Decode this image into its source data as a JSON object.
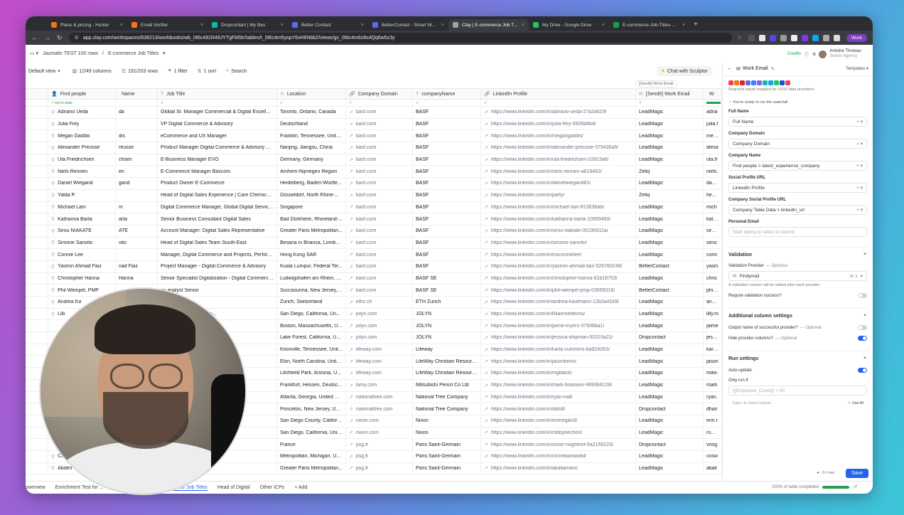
{
  "browser": {
    "tabs": [
      {
        "label": "Plans & pricing - Hunter",
        "color": "#f97316"
      },
      {
        "label": "Email Verifier",
        "color": "#f97316"
      },
      {
        "label": "Dropcontact | My files",
        "color": "#14b8a6"
      },
      {
        "label": "Better Contact",
        "color": "#6366f1"
      },
      {
        "label": "BetterContact - Smart Waterf",
        "color": "#6366f1"
      },
      {
        "label": "Clay | E-commerce Job Titles",
        "color": "#9ca3af",
        "active": true
      },
      {
        "label": "My Drive - Google Drive",
        "color": "#22c55e"
      },
      {
        "label": "E-commerce-Job-Titles-Defa",
        "color": "#16a34a"
      }
    ],
    "new_tab": "+",
    "url": "app.clay.com/workspaces/638213/workbooks/wb_0t6c481R49JYTgFM5tr/tables/t_0t6c4m5yspY6xH6Nbb2/views/gv_0t6c4m6z8s4Qq6w5z3y",
    "profile_label": "Work"
  },
  "app": {
    "breadcrumbs": [
      "Jaumatic TEST 100 rows",
      "/",
      "E-commerce Job Titles"
    ],
    "credits": "Credits",
    "user_name": "Antoine Thoreau",
    "user_org": "Sendo Agency"
  },
  "toolbar": {
    "view": "Default view",
    "columns": "12/49 columns",
    "rows": "191/203 rows",
    "filter": "1 filter",
    "sort": "1 sort",
    "search": "Search",
    "chat": "Chat with Sculptor",
    "formula_hint": "[Sendō] Work Email"
  },
  "grid": {
    "headers": [
      "Find people",
      "Name",
      "Job Title",
      "Location",
      "Company Domain",
      "companyName",
      "LinkedIn Profile",
      "[Sendō] Work Email",
      "W"
    ],
    "status_label": "Up to date",
    "rows": [
      {
        "p": "Adriano Ueda",
        "n": "da",
        "j": "Global Sr. Manager Commercial & Digital Excellenc...",
        "l": "Toronto, Ontario, Canada",
        "d": "basf.com",
        "c": "BASF",
        "li": "https://www.linkedin.com/in/adriano-ueda-27a2a619/",
        "w": "LeadMagic",
        "x": "adria"
      },
      {
        "p": "Julia Frey",
        "n": "",
        "j": "VP Digital Commerce & Advisory",
        "l": "Deutschland",
        "d": "basf.com",
        "c": "BASF",
        "li": "https://www.linkedin.com/in/julia-frey-0506b8b4/",
        "w": "LeadMagic",
        "x": "julia.f"
      },
      {
        "p": "Megan Gaddis",
        "n": "dis",
        "j": "eCommerce and UX Manager",
        "l": "Franklin, Tennessee, Unite...",
        "d": "basf.com",
        "c": "BASF",
        "li": "https://www.linkedin.com/in/megangaddis/",
        "w": "LeadMagic",
        "x": "mega"
      },
      {
        "p": "Alexander Preusse",
        "n": "reusse",
        "j": "Product Manager Digital Commerce & Advisory Chi...",
        "l": "Nanjing, Jiangsu, China",
        "d": "basf.com",
        "c": "BASF",
        "li": "https://www.linkedin.com/in/alexander-preusse-375436a5/",
        "w": "LeadMagic",
        "x": "alexa"
      },
      {
        "p": "Uta Friedrichsen",
        "n": "chsen",
        "j": "E-Business Manager EVO",
        "l": "Germany, Germany",
        "d": "basf.com",
        "c": "BASF",
        "li": "https://www.linkedin.com/in/uta-friedrichsen-22813a6/",
        "w": "LeadMagic",
        "x": "uta.fr"
      },
      {
        "p": "Niels Rennen",
        "n": "en",
        "j": "E-Commerce Manager Bascom",
        "l": "Arnhem-Nijmegen Region",
        "d": "basf.com",
        "c": "BASF",
        "li": "https://www.linkedin.com/in/niels-rennen-a819492/",
        "w": "Zeliq",
        "x": "niels."
      },
      {
        "p": "Daniel Wiegand",
        "n": "gand",
        "j": "Product Owner E-Commerce",
        "l": "Heidelberg, Baden-Württe...",
        "d": "basf.com",
        "c": "BASF",
        "li": "https://www.linkedin.com/in/danielwiegand81/",
        "w": "LeadMagic",
        "x": "danie"
      },
      {
        "p": "Yalda P.",
        "n": "",
        "j": "Head of Digital Sales Experience | Care Chemicals ...",
        "l": "Düsseldorf, North Rhine-...",
        "d": "basf.com",
        "c": "BASF",
        "li": "https://www.linkedin.com/in/party/",
        "w": "Zeliq",
        "x": "heary"
      },
      {
        "p": "Michael Lam",
        "n": "m",
        "j": "Digital Commerce Manager, Global Digital Services",
        "l": "Singapore",
        "d": "basf.com",
        "c": "BASF",
        "li": "https://www.linkedin.com/in/michael-lam-813636ab/",
        "w": "LeadMagic",
        "x": "mich"
      },
      {
        "p": "Katharina Barta",
        "n": "arta",
        "j": "Senior Business Consultant Digital Sales",
        "l": "Bad Dürkheim, Rhineland-...",
        "d": "basf.com",
        "c": "BASF",
        "li": "https://www.linkedin.com/in/katharina-barta-10959450/",
        "w": "LeadMagic",
        "x": "katha"
      },
      {
        "p": "Sirou NIAKATE",
        "n": "ATE",
        "j": "Account Manager: Digital Sales Representative",
        "l": "Greater Paris Metropolitan...",
        "d": "basf.com",
        "c": "BASF",
        "li": "https://www.linkedin.com/in/sirou-niakate-00190311a/",
        "w": "LeadMagic",
        "x": "sirou."
      },
      {
        "p": "Simone Sanvito",
        "n": "vito",
        "j": "Head of Digital Sales Team South-East",
        "l": "Besana in Brianza, Lombardi...",
        "d": "basf.com",
        "c": "BASF",
        "li": "https://www.linkedin.com/in/simone-sanvito/",
        "w": "LeadMagic",
        "x": "simo"
      },
      {
        "p": "Connie Lee",
        "n": "",
        "j": "Manager, Digital Commerce and Projects, Perform...",
        "l": "Hong Kong SAR",
        "d": "basf.com",
        "c": "BASF",
        "li": "https://www.linkedin.com/in/msconnielee/",
        "w": "LeadMagic",
        "x": "conn"
      },
      {
        "p": "Yasmin Ahmad Faiz",
        "n": "nad Faiz",
        "j": "Project Manager - Digital Commerce & Advisory",
        "l": "Kuala Lumpur, Federal Ter...",
        "d": "basf.com",
        "c": "BASF",
        "li": "https://www.linkedin.com/in/yasmin-ahmad-faiz-526760249/",
        "w": "BetterContact",
        "x": "yasm"
      },
      {
        "p": "Christopher Hanna",
        "n": "Hanna",
        "j": "Senior Specialist Digitalization - Digital Commerce,...",
        "l": "Ludwigshafen am Rhein, R...",
        "d": "basf.com",
        "c": "BASF SE",
        "li": "https://www.linkedin.com/in/christopher-hanna-61b18753/",
        "w": "LeadMagic",
        "x": "chris"
      },
      {
        "p": "Phil Weinpel, PMP",
        "n": "",
        "j": "ce analyst Senior",
        "l": "Succasunna, New Jersey, ...",
        "d": "basf.com",
        "c": "BASF SE",
        "li": "https://www.linkedin.com/in/phil-weinpel-pmp-03555016/",
        "w": "BetterContact",
        "x": "phil.w"
      },
      {
        "p": "Andrea Ka",
        "n": "",
        "j": "sing",
        "l": "Zurich, Switzerland",
        "d": "ethz.ch",
        "c": "ETH Zurich",
        "li": "https://www.linkedin.com/in/andrea-kaufmann-12b2a41b9/",
        "w": "LeadMagic",
        "x": "andre"
      },
      {
        "p": "Lilli",
        "n": "",
        "j": "ndising & Usability Man...",
        "l": "San Diego, California, Un...",
        "d": "jolyn.com",
        "c": "JOLYN",
        "li": "https://www.linkedin.com/in/lillianmedeiros/",
        "w": "LeadMagic",
        "x": "lilly.m"
      },
      {
        "p": "",
        "n": "",
        "j": "",
        "l": "Boston, Massachusetts, U...",
        "d": "jolyn.com",
        "c": "JOLYN",
        "li": "https://www.linkedin.com/in/jaime-myers-37936ba1/",
        "w": "LeadMagic",
        "x": "jaime"
      },
      {
        "p": "",
        "n": "",
        "j": "Merchandising",
        "l": "Lake Forest, California, Un...",
        "d": "jolyn.com",
        "c": "JOLYN",
        "li": "https://www.linkedin.com/in/jessica-shipman-50223a21/",
        "w": "Dropcontact",
        "x": "jessic"
      },
      {
        "p": "",
        "n": "",
        "j": "mmerce Conte...",
        "l": "Knoxville, Tennessee, Unit...",
        "d": "lifeway.com",
        "c": "Lifeway",
        "li": "https://www.linkedin.com/in/karla-cummins-ba924263/",
        "w": "LeadMagic",
        "x": "karla."
      },
      {
        "p": "",
        "n": "",
        "j": "",
        "l": "Elon, North Carolina, Unite...",
        "d": "lifeway.com",
        "c": "LifeWay Christian Resources",
        "li": "https://www.linkedin.com/in/jasonbrinn/",
        "w": "LeadMagic",
        "x": "jason"
      },
      {
        "p": "",
        "n": "",
        "j": "ce",
        "l": "Litchfield Park, Arizona, U...",
        "d": "lifeway.com",
        "c": "LifeWay Christian Resources",
        "li": "https://www.linkedin.com/in/mgblack/",
        "w": "LeadMagic",
        "x": "mike."
      },
      {
        "p": "",
        "n": "",
        "j": "",
        "l": "Frankfurt, Hessen, Deutsc...",
        "d": "lamy.com",
        "c": "Mitsubishi Pencil Co Ltd",
        "li": "https://www.linkedin.com/in/mark-brasseur-9693b9128/",
        "w": "LeadMagic",
        "x": "mark"
      },
      {
        "p": "",
        "n": "",
        "j": "capabilities",
        "l": "Atlanta, Georgia, United St...",
        "d": "nationaltree.com",
        "c": "National Tree Company",
        "li": "https://www.linkedin.com/in/ryan-nall/",
        "w": "LeadMagic",
        "x": "ryan."
      },
      {
        "p": "",
        "n": "",
        "j": "",
        "l": "Princeton, New Jersey, Un...",
        "d": "nationaltree.com",
        "c": "National Tree Company",
        "li": "https://www.linkedin.com/in/dahill/",
        "w": "Dropcontact",
        "x": "dhari"
      },
      {
        "p": "",
        "n": "",
        "j": "",
        "l": "San Diego County, Californ...",
        "d": "nixon.com",
        "c": "Nixon",
        "li": "https://www.linkedin.com/in/erinregan3/",
        "w": "LeadMagic",
        "x": "erin.r"
      },
      {
        "p": "",
        "n": "",
        "j": "",
        "l": "San Diego, California, Unit...",
        "d": "nixon.com",
        "c": "Nixon",
        "li": "https://www.linkedin.com/in/robbynechon/",
        "w": "LeadMagic",
        "x": "robby"
      },
      {
        "p": "",
        "n": "",
        "j": "manager",
        "l": "France",
        "d": "psg.fr",
        "c": "Paris Saint-Germain",
        "li": "https://www.linkedin.com/in/victor-nogherot-5a2156223/",
        "w": "Dropcontact",
        "x": "vnog"
      },
      {
        "p": "Co",
        "n": "",
        "j": "ct Manager",
        "l": "Metropolitan, Michigan, U...",
        "d": "psg.fr",
        "c": "Paris Saint-Germain",
        "li": "https://www.linkedin.com/in/corneliaoswald/",
        "w": "LeadMagic",
        "x": "cosw"
      },
      {
        "p": "Abdérr",
        "n": "",
        "j": "merce",
        "l": "Greater Paris Metropolitan...",
        "d": "psg.fr",
        "c": "Paris Saint-Germain",
        "li": "https://www.linkedin.com/in/abaliamani/",
        "w": "LeadMagic",
        "x": "abali"
      }
    ]
  },
  "bottom_tabs": [
    "overview",
    "Enrichment Test for ...",
    "for ICP 1 and...",
    "E-commerce Job Titles",
    "Head of Digital",
    "Other ICPs",
    "+ Add"
  ],
  "progress": {
    "label": "100% of table completed",
    "value": 1.0
  },
  "panel": {
    "title": "Work Email",
    "templates": "Templates",
    "required_note": "Required inputs mapped for 10/10 data providers!",
    "ready_note": "You're ready to run the waterfall",
    "fields": [
      {
        "label": "Full Name",
        "value": "Full Name"
      },
      {
        "label": "Company Domain",
        "value": "Company Domain"
      },
      {
        "label": "Company Name",
        "value": "Find people  >  latest_experience_company"
      },
      {
        "label": "Social Profile URL",
        "value": "LinkedIn Profile"
      },
      {
        "label": "Company Social Profile URL",
        "value": "Company Table Data  >  linkedin_url"
      },
      {
        "label": "Personal Email",
        "value": "Start typing or select a column",
        "placeholder": true
      }
    ],
    "validation": {
      "title": "Validation",
      "provider_label": "Validation Provider",
      "optional": "— Optional",
      "provider_value": "Findymail",
      "provider_meta": "or  1",
      "provider_note": "A validation column will be added after each provider",
      "require_label": "Require validation success?"
    },
    "additional": {
      "title": "Additional column settings",
      "output_label": "Output name of successful provider?",
      "output_optional": "— Optional",
      "hide_label": "Hide provider columns?",
      "hide_optional": "— Optional"
    },
    "run": {
      "title": "Run settings",
      "auto_label": "Auto-update",
      "only_label": "Only run if",
      "formula": "{{Employee_Count}} > 50",
      "type_hint": "Type / to insert column",
      "use_ai": "Use AI"
    },
    "cost": "~3 / row",
    "save": "Save"
  },
  "colors": {
    "accent": "#2563eb",
    "success": "#22a04b"
  }
}
